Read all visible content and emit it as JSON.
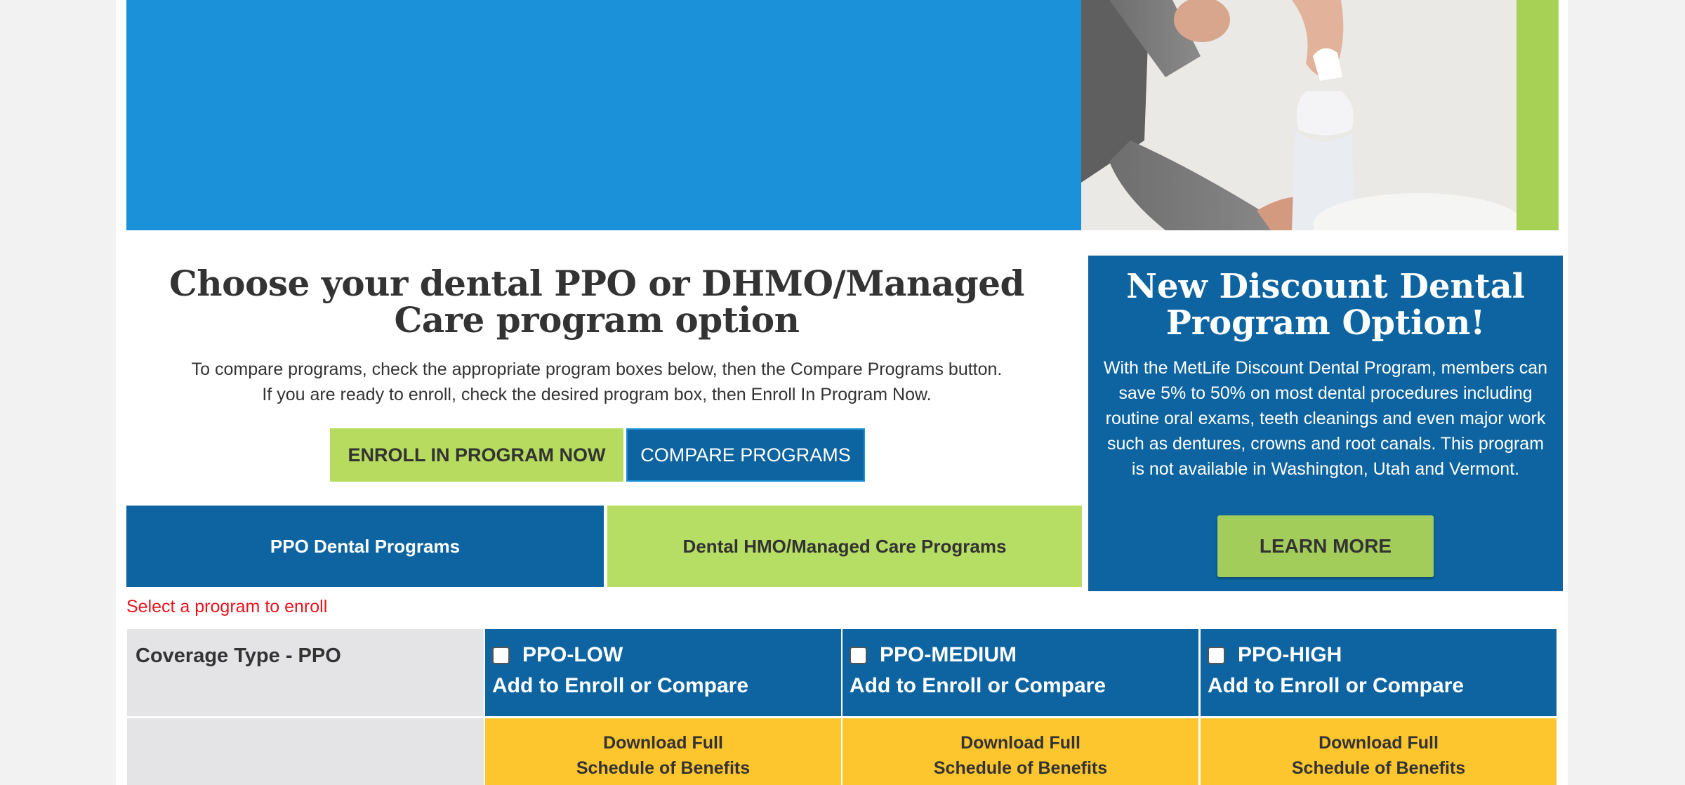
{
  "hero": {
    "colors": {
      "blue": "#1a91d9",
      "green": "#a6d155"
    }
  },
  "intro": {
    "title": "Choose your dental PPO or DHMO/Managed Care program option",
    "instruction_line1": "To compare programs, check the appropriate program boxes below, then the Compare Programs button.",
    "instruction_line2": "If you are ready to enroll, check the desired program box, then Enroll In Program Now."
  },
  "actions": {
    "enroll_label": "ENROLL IN PROGRAM NOW",
    "compare_label": "COMPARE PROGRAMS"
  },
  "tabs": [
    {
      "label": "PPO Dental Programs",
      "active": true
    },
    {
      "label": "Dental HMO/Managed Care Programs",
      "active": false
    }
  ],
  "promo": {
    "title": "New Discount Dental Program Option!",
    "text": "With the MetLife Discount Dental Program, members can save 5% to 50% on most dental procedures including routine oral exams, teeth cleanings and even major work such as dentures, crowns and root canals. This program is not available in Washington, Utah and Vermont.",
    "button_label": "LEARN MORE"
  },
  "select_message": "Select a program to enroll",
  "table": {
    "coverage_label": "Coverage Type - PPO",
    "plans": [
      {
        "name": "PPO-LOW",
        "action": "Add to Enroll or Compare",
        "checked": false
      },
      {
        "name": "PPO-MEDIUM",
        "action": "Add to Enroll or Compare",
        "checked": false
      },
      {
        "name": "PPO-HIGH",
        "action": "Add to Enroll or Compare",
        "checked": false
      }
    ],
    "download_line1": "Download Full",
    "download_line2": "Schedule of Benefits"
  },
  "colors": {
    "primary_blue": "#0d64a0",
    "lime": "#b6db5e",
    "gold": "#fdc52e",
    "alert_red": "#e8141e"
  }
}
